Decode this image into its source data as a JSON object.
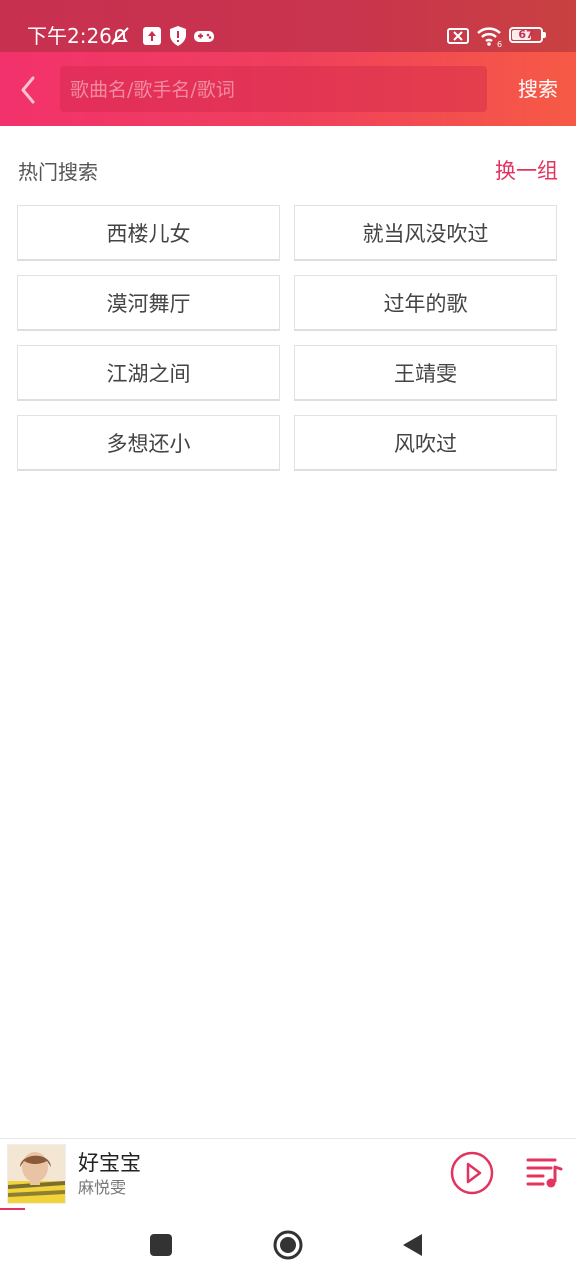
{
  "status_bar": {
    "time": "下午2:26",
    "battery_level": "67"
  },
  "search": {
    "placeholder": "歌曲名/歌手名/歌词",
    "button_label": "搜索"
  },
  "hot_search": {
    "title": "热门搜索",
    "refresh_label": "换一组",
    "tags": [
      "西楼儿女",
      "就当风没吹过",
      "漠河舞厅",
      "过年的歌",
      "江湖之间",
      "王靖雯",
      "多想还小",
      "风吹过"
    ]
  },
  "mini_player": {
    "song_title": "好宝宝",
    "artist": "麻悦雯",
    "progress": 0.04
  },
  "colors": {
    "accent": "#e2345e",
    "header_start": "#f2326c",
    "header_end": "#f65a45"
  },
  "icons": {
    "back": "chevron-left-icon",
    "play": "play-circle-icon",
    "playlist": "playlist-icon"
  }
}
